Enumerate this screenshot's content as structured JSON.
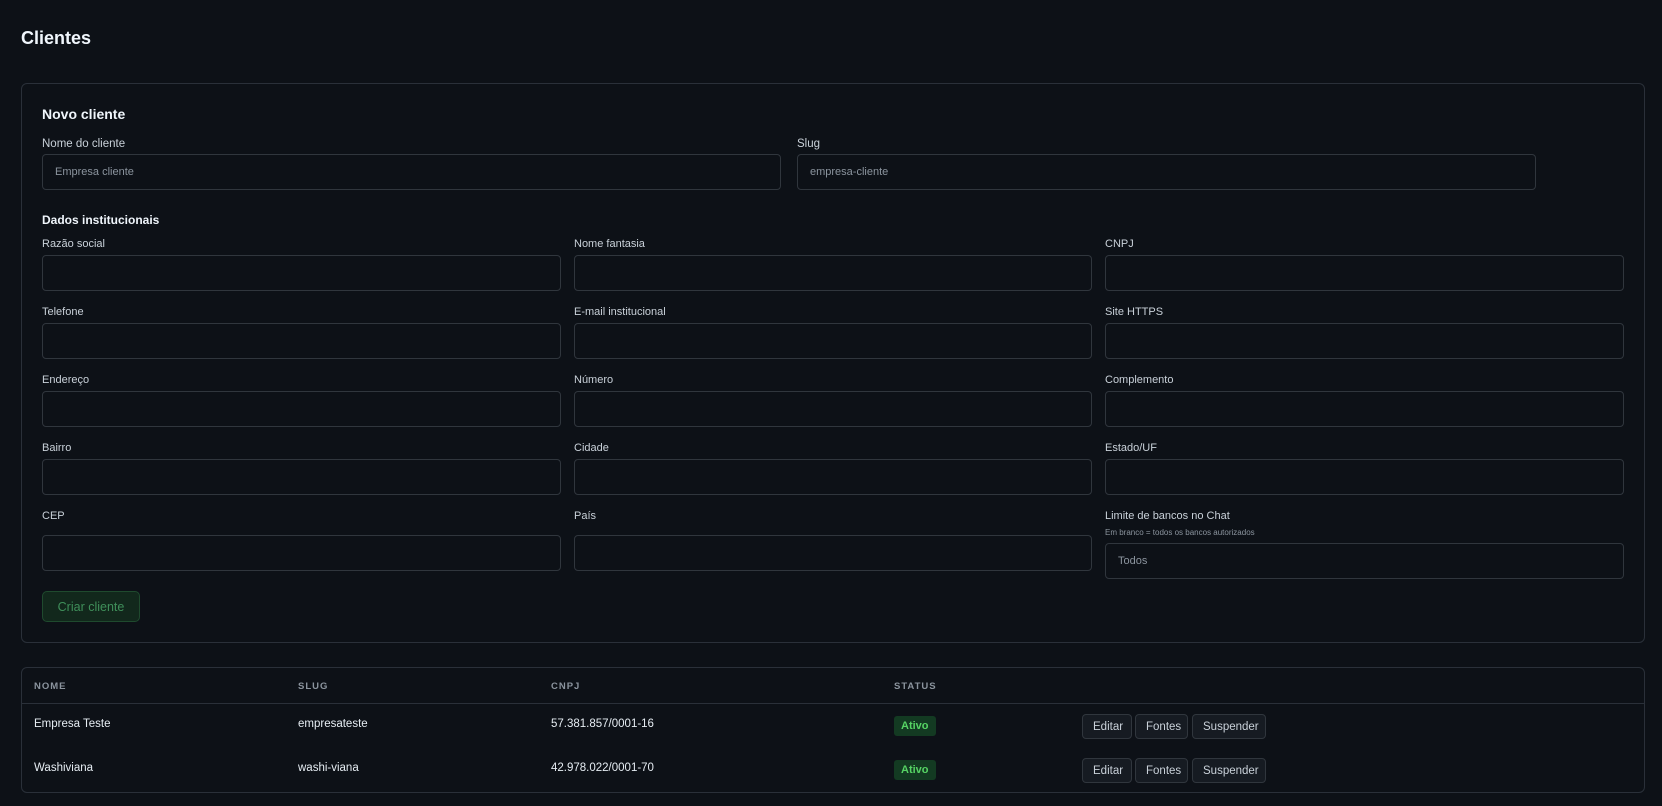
{
  "page": {
    "title": "Clientes"
  },
  "form": {
    "title": "Novo cliente",
    "name_label": "Nome do cliente",
    "name_placeholder": "Empresa cliente",
    "slug_label": "Slug",
    "slug_placeholder": "empresa-cliente",
    "section_title": "Dados institucionais",
    "fields": {
      "razao_social": "Razão social",
      "nome_fantasia": "Nome fantasia",
      "cnpj": "CNPJ",
      "telefone": "Telefone",
      "email": "E-mail institucional",
      "site": "Site HTTPS",
      "endereco": "Endereço",
      "numero": "Número",
      "complemento": "Complemento",
      "bairro": "Bairro",
      "cidade": "Cidade",
      "estado": "Estado/UF",
      "cep": "CEP",
      "pais": "País",
      "limite": "Limite de bancos no Chat"
    },
    "limite_hint": "Em branco = todos os bancos autorizados",
    "limite_placeholder": "Todos",
    "submit_label": "Criar cliente"
  },
  "table": {
    "headers": {
      "nome": "NOME",
      "slug": "SLUG",
      "cnpj": "CNPJ",
      "status": "STATUS"
    },
    "rows": [
      {
        "nome": "Empresa Teste",
        "slug": "empresateste",
        "cnpj": "57.381.857/0001-16",
        "status": "Ativo"
      },
      {
        "nome": "Washiviana",
        "slug": "washi-viana",
        "cnpj": "42.978.022/0001-70",
        "status": "Ativo"
      }
    ],
    "actions": {
      "edit": "Editar",
      "sources": "Fontes",
      "suspend": "Suspender"
    }
  },
  "colors": {
    "background": "#0d1117",
    "border": "#2a3039",
    "status_active_bg": "#133a22",
    "status_active_text": "#56d364",
    "create_button_bg": "#12281c"
  }
}
